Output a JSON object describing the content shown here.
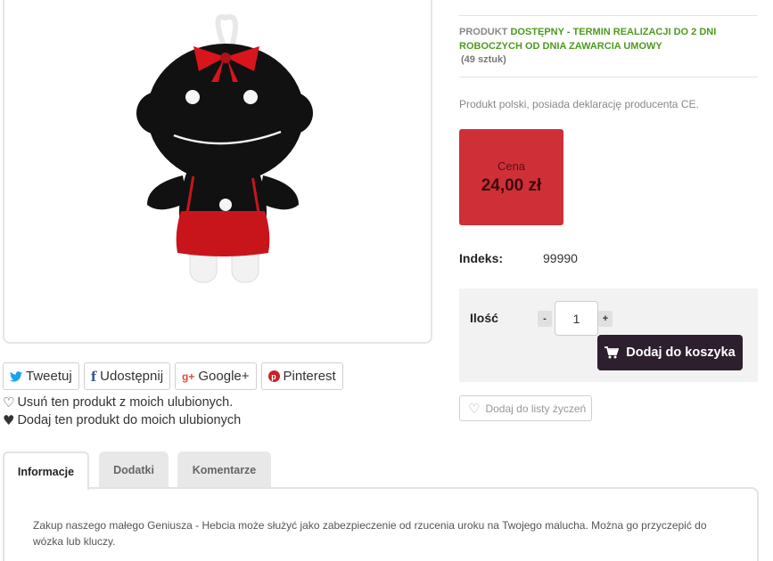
{
  "product_image": {
    "alt": "Hebcia"
  },
  "social": {
    "tweet": "Tweetuj",
    "share": "Udostępnij",
    "google": "Google+",
    "pinterest": "Pinterest"
  },
  "favorites": {
    "remove": "Usuń ten produkt z moich ulubionych.",
    "add": "Dodaj ten produkt do moich ulubionych"
  },
  "availability": {
    "label": "PRODUKT",
    "value": "DOSTĘPNY - TERMIN REALIZACJI DO 2 DNI ROBOCZYCH OD DNIA ZAWARCIA UMOWY",
    "count": "(49 sztuk)"
  },
  "description_short": "Produkt polski, posiada deklarację producenta CE.",
  "price": {
    "label": "Cena",
    "value": "24,00 zł"
  },
  "index": {
    "label": "Indeks:",
    "value": "99990"
  },
  "cart": {
    "qty_label": "Ilość",
    "minus": "-",
    "plus": "+",
    "qty_value": "1",
    "add_label": "Dodaj do koszyka"
  },
  "wishlist": {
    "label": "Dodaj do listy życzeń"
  },
  "tabs": [
    {
      "label": "Informacje"
    },
    {
      "label": "Dodatki"
    },
    {
      "label": "Komentarze"
    }
  ],
  "tab_content": "Zakup naszego małego Geniusza - Hebcia może służyć jako zabezpieczenie od rzucenia uroku na Twojego malucha. Można go przyczepić do wózka lub kluczy.",
  "colors": {
    "price_bg": "#cf2f37",
    "cart_button": "#2d1f2e",
    "availability": "#4d9a1f"
  }
}
